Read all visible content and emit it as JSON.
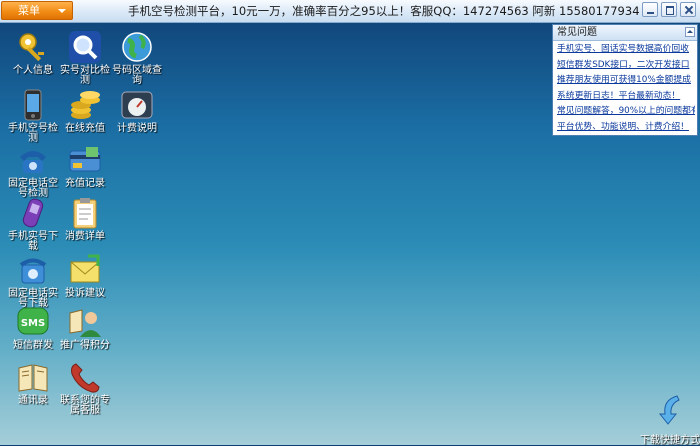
{
  "menu": {
    "label": "菜单"
  },
  "header": {
    "title": "手机空号检测平台，10元一万，准确率百分之95以上！客服QQ：147274563 阿新 15580177934"
  },
  "window_controls": [
    "minimize-icon",
    "maximize-icon",
    "close-icon"
  ],
  "desktop_icons": [
    {
      "label": "个人信息",
      "icon": "key-icon"
    },
    {
      "label": "实号对比检测",
      "icon": "magnifier-icon"
    },
    {
      "label": "号码区域查询",
      "icon": "globe-icon"
    },
    {
      "label": "手机空号检测",
      "icon": "mobile-phone-icon"
    },
    {
      "label": "在线充值",
      "icon": "coins-icon"
    },
    {
      "label": "计费说明",
      "icon": "dashboard-icon"
    },
    {
      "label": "固定电话空号检测",
      "icon": "telephone-icon"
    },
    {
      "label": "充值记录",
      "icon": "bank-card-icon"
    },
    {
      "label": "手机实号下载",
      "icon": "purple-phone-icon"
    },
    {
      "label": "消费详单",
      "icon": "clipboard-icon"
    },
    {
      "label": "固定电话实号下载",
      "icon": "blue-telephone-icon"
    },
    {
      "label": "投诉建议",
      "icon": "envelope-icon"
    },
    {
      "label": "短信群发",
      "icon": "sms-icon"
    },
    {
      "label": "推广得积分",
      "icon": "person-book-icon"
    },
    {
      "label": "通讯录",
      "icon": "address-book-icon"
    },
    {
      "label": "联系您的专属客服",
      "icon": "handset-icon"
    }
  ],
  "faq": {
    "title": "常见问题",
    "items": [
      "手机实号、固话实号数据高价回收",
      "短信群发SDK接口，二次开发接口",
      "推荐朋友使用可获得10%金额提成",
      "系统更新日志！平台最新动态！",
      "常见问题解答，90%以上的问题都有",
      "平台优势、功能说明、计费介绍！"
    ]
  },
  "download": {
    "label": "下载快捷方式",
    "icon": "download-arrow-icon"
  },
  "colors": {
    "menu_orange": "#f08a12",
    "link_blue": "#0b3a9c",
    "desktop_top": "#0f3f73",
    "desktop_bottom": "#a5ced8"
  }
}
